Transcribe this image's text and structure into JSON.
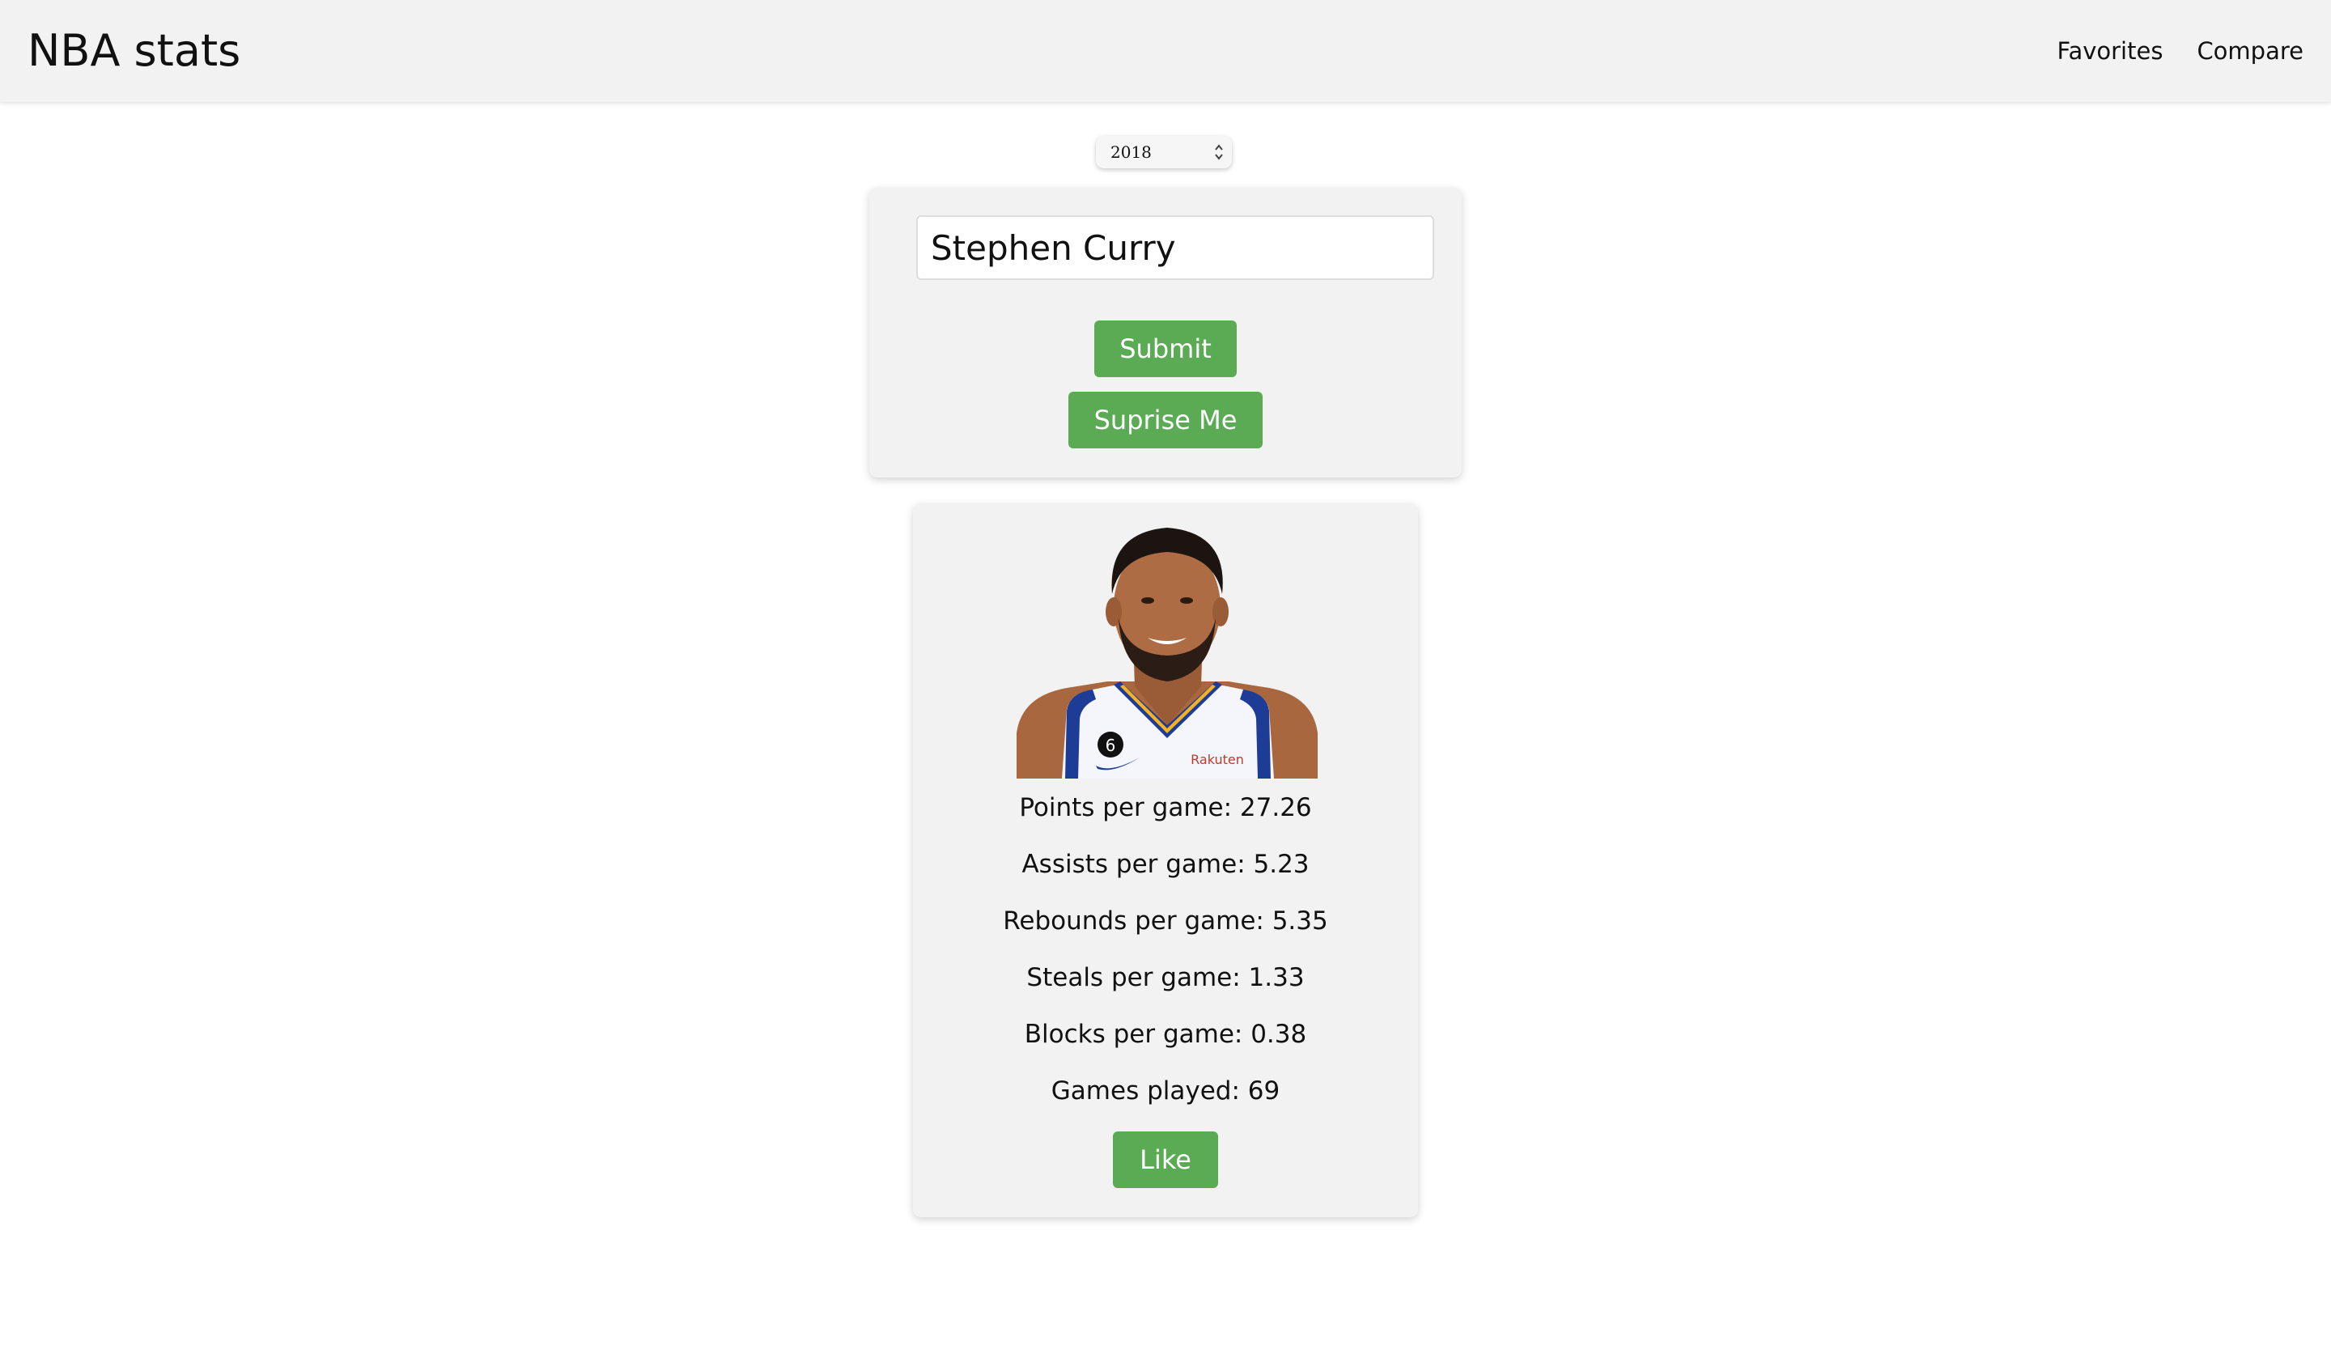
{
  "header": {
    "title": "NBA stats",
    "nav": [
      {
        "label": "Favorites"
      },
      {
        "label": "Compare"
      }
    ]
  },
  "year_selector": {
    "value": "2018"
  },
  "search": {
    "input_value": "Stephen Curry",
    "submit_label": "Submit",
    "surprise_label": "Suprise Me"
  },
  "player": {
    "photo_icon": "player-headshot",
    "jersey_number": "6",
    "jersey_sponsor": "Rakuten",
    "stats": {
      "points": "Points per game: 27.26",
      "assists": "Assists per game: 5.23",
      "rebounds": "Rebounds per game: 5.35",
      "steals": "Steals per game: 1.33",
      "blocks": "Blocks per game: 0.38",
      "games": "Games played: 69"
    },
    "like_label": "Like"
  },
  "colors": {
    "accent_green": "#5aab54",
    "header_bg": "#f2f2f2",
    "card_bg": "#f2f2f2",
    "jersey_blue": "#1d3c96",
    "jersey_gold": "#f4b223"
  }
}
